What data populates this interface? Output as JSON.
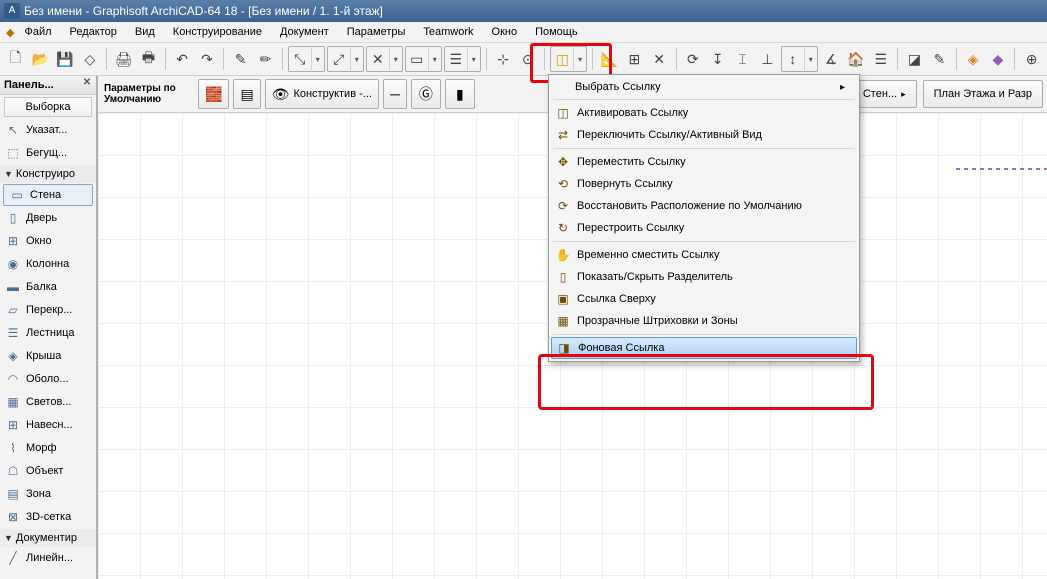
{
  "title": "Без имени - Graphisoft ArchiCAD-64 18 - [Без имени / 1. 1-й этаж]",
  "menu": [
    "Файл",
    "Редактор",
    "Вид",
    "Конструирование",
    "Документ",
    "Параметры",
    "Teamwork",
    "Окно",
    "Помощь"
  ],
  "sidebar": {
    "panel_title": "Панель...",
    "select_btn": "Выборка",
    "items": [
      {
        "label": "Указат...",
        "icon": "▷"
      },
      {
        "label": "Бегущ...",
        "icon": "⬚"
      }
    ],
    "cat": "Конструиро",
    "tools": [
      {
        "label": "Стена",
        "icon": "▭",
        "selected": true
      },
      {
        "label": "Дверь",
        "icon": "🚪"
      },
      {
        "label": "Окно",
        "icon": "⊞"
      },
      {
        "label": "Колонна",
        "icon": "◉"
      },
      {
        "label": "Балка",
        "icon": "▬"
      },
      {
        "label": "Перекр...",
        "icon": "▱"
      },
      {
        "label": "Лестница",
        "icon": "⌯"
      },
      {
        "label": "Крыша",
        "icon": "◈"
      },
      {
        "label": "Оболо...",
        "icon": "⟋"
      },
      {
        "label": "Светов...",
        "icon": "▦"
      },
      {
        "label": "Навесн...",
        "icon": "⊞"
      },
      {
        "label": "Морф",
        "icon": "⌇"
      },
      {
        "label": "Объект",
        "icon": "🪑"
      },
      {
        "label": "Зона",
        "icon": "▤"
      },
      {
        "label": "3D-сетка",
        "icon": "⊠"
      }
    ],
    "cat2": "Документир",
    "last": "Линейн..."
  },
  "params_label": "Параметры по Умолчанию",
  "construct_btn": "Конструктив -...",
  "rightbtns": {
    "wall": "...ая Стен...",
    "plan": "План Этажа и Разр"
  },
  "dropdown": {
    "head": "Выбрать Ссылку",
    "items": [
      "Активировать Ссылку",
      "Переключить Ссылку/Активный Вид",
      "Переместить Ссылку",
      "Повернуть Ссылку",
      "Восстановить Расположение по Умолчанию",
      "Перестроить Ссылку",
      "Временно сместить Ссылку",
      "Показать/Скрыть Разделитель",
      "Ссылка Сверху",
      "Прозрачные Штриховки и Зоны",
      "Фоновая Ссылка"
    ]
  }
}
